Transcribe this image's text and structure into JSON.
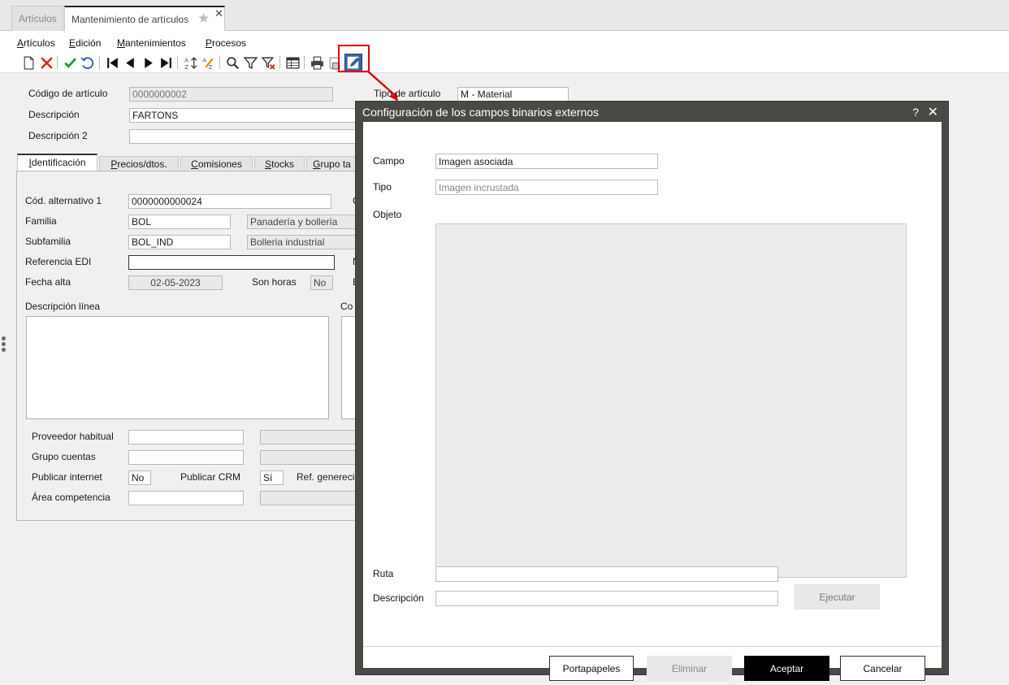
{
  "tabs": [
    {
      "label": "Artículos"
    },
    {
      "label": "Mantenimiento de artículos"
    }
  ],
  "menu": [
    "Artículos",
    "Edición",
    "Mantenimientos",
    "Procesos"
  ],
  "form": {
    "codigo_label": "Código de artículo",
    "codigo_value": "0000000002",
    "tipo_label": "Tipo de artículo",
    "tipo_value": "M  - Material",
    "descripcion_label": "Descripción",
    "descripcion_value": "FARTONS",
    "descripcion2_label": "Descripción 2",
    "descripcion2_value": ""
  },
  "form_tabs": [
    "Identificación",
    "Precios/dtos.",
    "Comisiones",
    "Stocks",
    "Grupo ta"
  ],
  "ident": {
    "cod_alt_label": "Cód. alternativo 1",
    "cod_alt_value": "0000000000024",
    "familia_label": "Familia",
    "familia_code": "BOL",
    "familia_desc": "Panadería y bollería",
    "subfamilia_label": "Subfamilia",
    "subfamilia_code": "BOL_IND",
    "subfamilia_desc": "Bolleria industrial",
    "ref_edi_label": "Referencia EDI",
    "ref_edi_value": "",
    "fecha_alta_label": "Fecha alta",
    "fecha_alta_value": "02-05-2023",
    "son_horas_label": "Son horas",
    "son_horas_value": "No",
    "desc_linea_label": "Descripción línea",
    "com_label": "Co",
    "side_c": "C",
    "side_n": "N",
    "side_e": "E",
    "proveedor_label": "Proveedor habitual",
    "proveedor_value": "",
    "grupo_cuentas_label": "Grupo cuentas",
    "grupo_cuentas_value": "",
    "publicar_internet_label": "Publicar internet",
    "publicar_internet_value": "No",
    "publicar_crm_label": "Publicar CRM",
    "publicar_crm_value": "Sí",
    "ref_generica_label": "Ref. generecia",
    "area_label": "Área competencia",
    "area_value": ""
  },
  "dialog": {
    "title": "Configuración de los campos binarios externos",
    "help": "?",
    "close": "✕",
    "campo_label": "Campo",
    "campo_value": "Imagen asociada",
    "tipo_label": "Tipo",
    "tipo_value": "Imagen incrustada",
    "objeto_label": "Objeto",
    "ruta_label": "Ruta",
    "ruta_value": "",
    "descripcion_label": "Descripción",
    "descripcion_value": "",
    "ejecutar": "Ejecutar",
    "portapapeles": "Portapapeles",
    "eliminar": "Eliminar",
    "aceptar": "Aceptar",
    "cancelar": "Cancelar"
  },
  "colors": {
    "highlight": "#e00000",
    "dialog_frame": "#4a4a45",
    "primary_button": "#000000",
    "accent_blue": "#3a66a8",
    "check_green": "#1a9a3a",
    "cancel_red": "#d42a1c"
  }
}
